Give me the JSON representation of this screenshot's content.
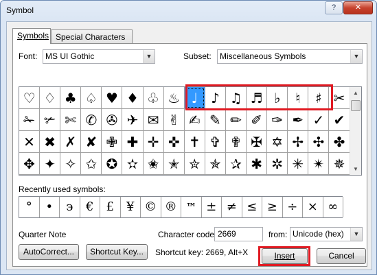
{
  "window": {
    "title": "Symbol",
    "help_label": "?",
    "close_label": "✕"
  },
  "tabs": [
    {
      "label": "Symbols",
      "active": true
    },
    {
      "label": "Special Characters",
      "active": false
    }
  ],
  "font": {
    "label": "Font:",
    "value": "MS UI Gothic"
  },
  "subset": {
    "label": "Subset:",
    "value": "Miscellaneous Symbols"
  },
  "symbols": [
    "♡",
    "♢",
    "♣",
    "♤",
    "♥",
    "♦",
    "♧",
    "♨",
    "♩",
    "♪",
    "♫",
    "♬",
    "♭",
    "♮",
    "♯",
    "✂",
    "✁",
    "✃",
    "✄",
    "✆",
    "✇",
    "✈",
    "✉",
    "✌",
    "✍",
    "✎",
    "✏",
    "✐",
    "✑",
    "✒",
    "✓",
    "✔",
    "✕",
    "✖",
    "✗",
    "✘",
    "✙",
    "✚",
    "✛",
    "✜",
    "✝",
    "✞",
    "✟",
    "✠",
    "✡",
    "✢",
    "✣",
    "✤",
    "✥",
    "✦",
    "✧",
    "✩",
    "✪",
    "✫",
    "✬",
    "✭",
    "✮",
    "✯",
    "✰",
    "✱",
    "✲",
    "✳",
    "✴",
    "✵"
  ],
  "selected_symbol": "♩",
  "scroll_arrows": {
    "up": "▲",
    "down": "▼"
  },
  "combo_arrow": "▼",
  "recent": {
    "label": "Recently used symbols:",
    "items": [
      "°",
      "•",
      "϶",
      "€",
      "£",
      "¥",
      "©",
      "®",
      "™",
      "±",
      "≠",
      "≤",
      "≥",
      "÷",
      "×",
      "∞"
    ]
  },
  "char_name": "Quarter Note",
  "char_code": {
    "label": "Character code:",
    "value": "2669"
  },
  "from": {
    "label": "from:",
    "value": "Unicode (hex)"
  },
  "buttons": {
    "autocorrect": "AutoCorrect...",
    "shortcut_key": "Shortcut Key...",
    "insert": "Insert",
    "cancel": "Cancel"
  },
  "shortcut_text": "Shortcut key: 2669, Alt+X",
  "colors": {
    "selection": "#3399ff",
    "highlight": "#e01a22"
  }
}
